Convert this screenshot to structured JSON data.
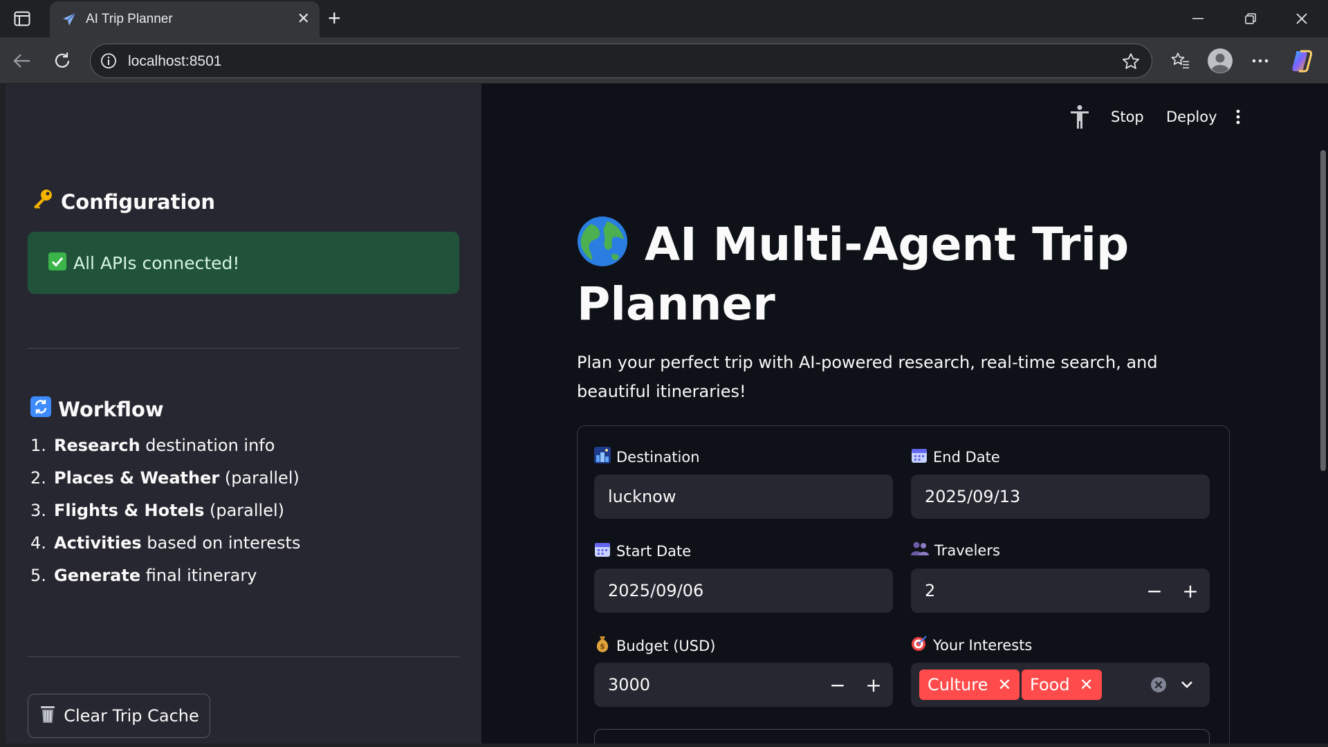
{
  "browser": {
    "tab_title": "AI Trip Planner",
    "url": "localhost:8501"
  },
  "header": {
    "stop_label": "Stop",
    "deploy_label": "Deploy"
  },
  "sidebar": {
    "config_heading": "Configuration",
    "config_icon": "key-emoji",
    "status_message": "All APIs connected!",
    "workflow_heading": "Workflow",
    "workflow_icon": "cycle-arrows-emoji",
    "workflow_steps": [
      {
        "num": "1.",
        "bold": "Research",
        "rest": " destination info"
      },
      {
        "num": "2.",
        "bold": "Places & Weather",
        "rest": " (parallel)"
      },
      {
        "num": "3.",
        "bold": "Flights & Hotels",
        "rest": " (parallel)"
      },
      {
        "num": "4.",
        "bold": "Activities",
        "rest": " based on interests"
      },
      {
        "num": "5.",
        "bold": "Generate",
        "rest": " final itinerary"
      }
    ],
    "clear_button": "Clear Trip Cache"
  },
  "main": {
    "title": "AI Multi-Agent Trip Planner",
    "title_icon": "globe-emoji",
    "subtitle": "Plan your perfect trip with AI-powered research, real-time search, and beautiful itineraries!",
    "form": {
      "destination_label": "Destination",
      "destination_value": "lucknow",
      "end_date_label": "End Date",
      "end_date_value": "2025/09/13",
      "start_date_label": "Start Date",
      "start_date_value": "2025/09/06",
      "travelers_label": "Travelers",
      "travelers_value": "2",
      "budget_label": "Budget (USD)",
      "budget_value": "3000",
      "interests_label": "Your Interests",
      "interests": [
        "Culture",
        "Food"
      ]
    }
  },
  "colors": {
    "accent": "#ff4b4b",
    "success_bg": "#21533a",
    "sidebar_bg": "#262730",
    "main_bg": "#0e1117"
  }
}
